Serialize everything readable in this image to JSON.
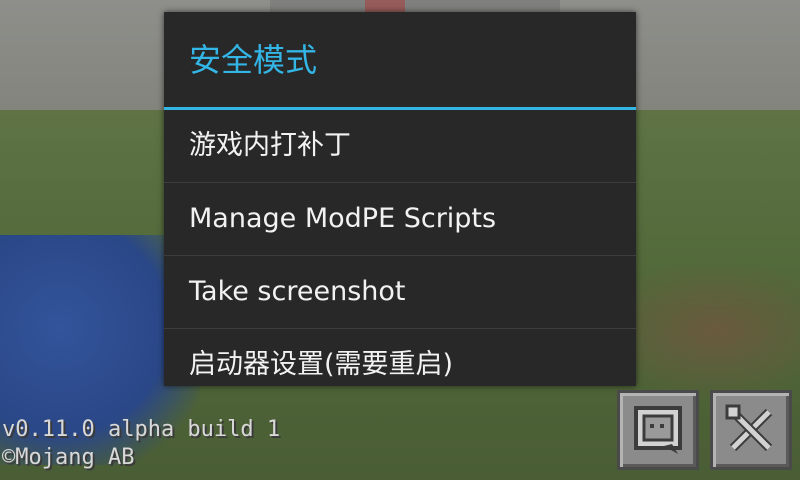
{
  "dialog": {
    "title": "安全模式",
    "items": [
      {
        "label": "游戏内打补丁"
      },
      {
        "label": "Manage ModPE Scripts"
      },
      {
        "label": "Take screenshot"
      },
      {
        "label": "启动器设置(需要重启)"
      }
    ]
  },
  "version": {
    "line1": "v0.11.0 alpha build 1",
    "line2": "©Mojang AB"
  },
  "buttons": {
    "chat_icon": "chat-bubble-icon",
    "settings_icon": "wrench-screwdriver-icon"
  },
  "colors": {
    "accent": "#33b5e5",
    "dialog_bg": "#282828"
  }
}
